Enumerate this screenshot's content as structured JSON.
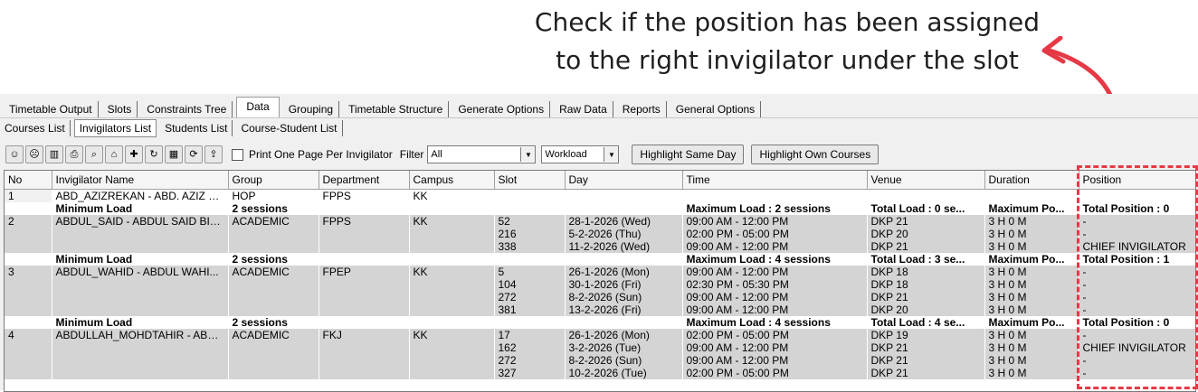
{
  "annotation": {
    "line1": "Check if the position has been assigned",
    "line2": "to the right invigilator under the slot",
    "color": "#e63946"
  },
  "tabs": [
    "Timetable Output",
    "Slots",
    "Constraints Tree",
    "Data",
    "Grouping",
    "Timetable Structure",
    "Generate Options",
    "Raw Data",
    "Reports",
    "General Options"
  ],
  "active_tab": "Data",
  "subtabs": [
    "Courses List",
    "Invigilators List",
    "Students List",
    "Course-Student List"
  ],
  "active_subtab": "Invigilators List",
  "toolbar": {
    "icons": [
      "add-person-icon",
      "remove-person-icon",
      "bin-icon",
      "print-icon",
      "print-preview-icon",
      "open-icon",
      "add-icon",
      "refresh-icon",
      "table-icon",
      "sync-icon",
      "export-icon"
    ],
    "print_checkbox_label": "Print One Page Per Invigilator",
    "print_checkbox_checked": false,
    "filter_label": "Filter",
    "filter_value": "All",
    "sort_value": "Workload",
    "highlight_same_day": "Highlight Same Day",
    "highlight_own_courses": "Highlight Own Courses"
  },
  "table": {
    "columns": [
      "No",
      "Invigilator Name",
      "Group",
      "Department",
      "Campus",
      "Slot",
      "Day",
      "Time",
      "Venue",
      "Duration",
      "Position"
    ],
    "rows": [
      {
        "kind": "main",
        "first": true,
        "cells": [
          "1",
          "ABD_AZIZREKAN - ABD. AZIZ B...",
          "HOP",
          "FPPS",
          "KK",
          "",
          "",
          "",
          "",
          "",
          ""
        ]
      },
      {
        "kind": "summary",
        "cells": [
          "",
          "Minimum Load",
          "2 sessions",
          "",
          "",
          "",
          "",
          "Maximum Load : 2 sessions",
          "Total Load : 0 se...",
          "Maximum Po...",
          "Total Position : 0"
        ]
      },
      {
        "kind": "grey",
        "cells": [
          "2",
          "ABDUL_SAID - ABDUL SAID BIN...",
          "ACADEMIC",
          "FPPS",
          "KK",
          "52",
          "28-1-2026 (Wed)",
          "09:00 AM - 12:00 PM",
          "DKP 21",
          "3 H 0 M",
          "-"
        ]
      },
      {
        "kind": "grey",
        "cells": [
          "",
          "",
          "",
          "",
          "",
          "216",
          "5-2-2026 (Thu)",
          "02:00 PM - 05:00 PM",
          "DKP 20",
          "3 H 0 M",
          "-"
        ]
      },
      {
        "kind": "grey",
        "cells": [
          "",
          "",
          "",
          "",
          "",
          "338",
          "11-2-2026 (Wed)",
          "09:00 AM - 12:00 PM",
          "DKP 21",
          "3 H 0 M",
          "CHIEF INVIGILATOR"
        ]
      },
      {
        "kind": "summary",
        "cells": [
          "",
          "Minimum Load",
          "2 sessions",
          "",
          "",
          "",
          "",
          "Maximum Load : 4 sessions",
          "Total Load : 3 se...",
          "Maximum Po...",
          "Total Position : 1"
        ]
      },
      {
        "kind": "grey",
        "cells": [
          "3",
          "ABDUL_WAHID - ABDUL WAHI...",
          "ACADEMIC",
          "FPEP",
          "KK",
          "5",
          "26-1-2026 (Mon)",
          "09:00 AM - 12:00 PM",
          "DKP 18",
          "3 H 0 M",
          "-"
        ]
      },
      {
        "kind": "grey",
        "cells": [
          "",
          "",
          "",
          "",
          "",
          "104",
          "30-1-2026 (Fri)",
          "02:30 PM - 05:30 PM",
          "DKP 18",
          "3 H 0 M",
          "-"
        ]
      },
      {
        "kind": "grey",
        "cells": [
          "",
          "",
          "",
          "",
          "",
          "272",
          "8-2-2026 (Sun)",
          "09:00 AM - 12:00 PM",
          "DKP 21",
          "3 H 0 M",
          "-"
        ]
      },
      {
        "kind": "grey",
        "cells": [
          "",
          "",
          "",
          "",
          "",
          "381",
          "13-2-2026 (Fri)",
          "09:00 AM - 12:00 PM",
          "DKP 20",
          "3 H 0 M",
          "-"
        ]
      },
      {
        "kind": "summary",
        "cells": [
          "",
          "Minimum Load",
          "2 sessions",
          "",
          "",
          "",
          "",
          "Maximum Load : 4 sessions",
          "Total Load : 4 se...",
          "Maximum Po...",
          "Total Position : 0"
        ]
      },
      {
        "kind": "grey",
        "cells": [
          "4",
          "ABDULLAH_MOHDTAHIR - ABD...",
          "ACADEMIC",
          "FKJ",
          "KK",
          "17",
          "26-1-2026 (Mon)",
          "02:00 PM - 05:00 PM",
          "DKP 19",
          "3 H 0 M",
          "-"
        ]
      },
      {
        "kind": "grey",
        "cells": [
          "",
          "",
          "",
          "",
          "",
          "162",
          "3-2-2026 (Tue)",
          "09:00 AM - 12:00 PM",
          "DKP 21",
          "3 H 0 M",
          "CHIEF INVIGILATOR"
        ]
      },
      {
        "kind": "grey",
        "cells": [
          "",
          "",
          "",
          "",
          "",
          "272",
          "8-2-2026 (Sun)",
          "09:00 AM - 12:00 PM",
          "DKP 21",
          "3 H 0 M",
          "-"
        ]
      },
      {
        "kind": "grey",
        "cells": [
          "",
          "",
          "",
          "",
          "",
          "327",
          "10-2-2026 (Tue)",
          "02:00 PM - 05:00 PM",
          "DKP 21",
          "3 H 0 M",
          "-"
        ]
      }
    ]
  }
}
